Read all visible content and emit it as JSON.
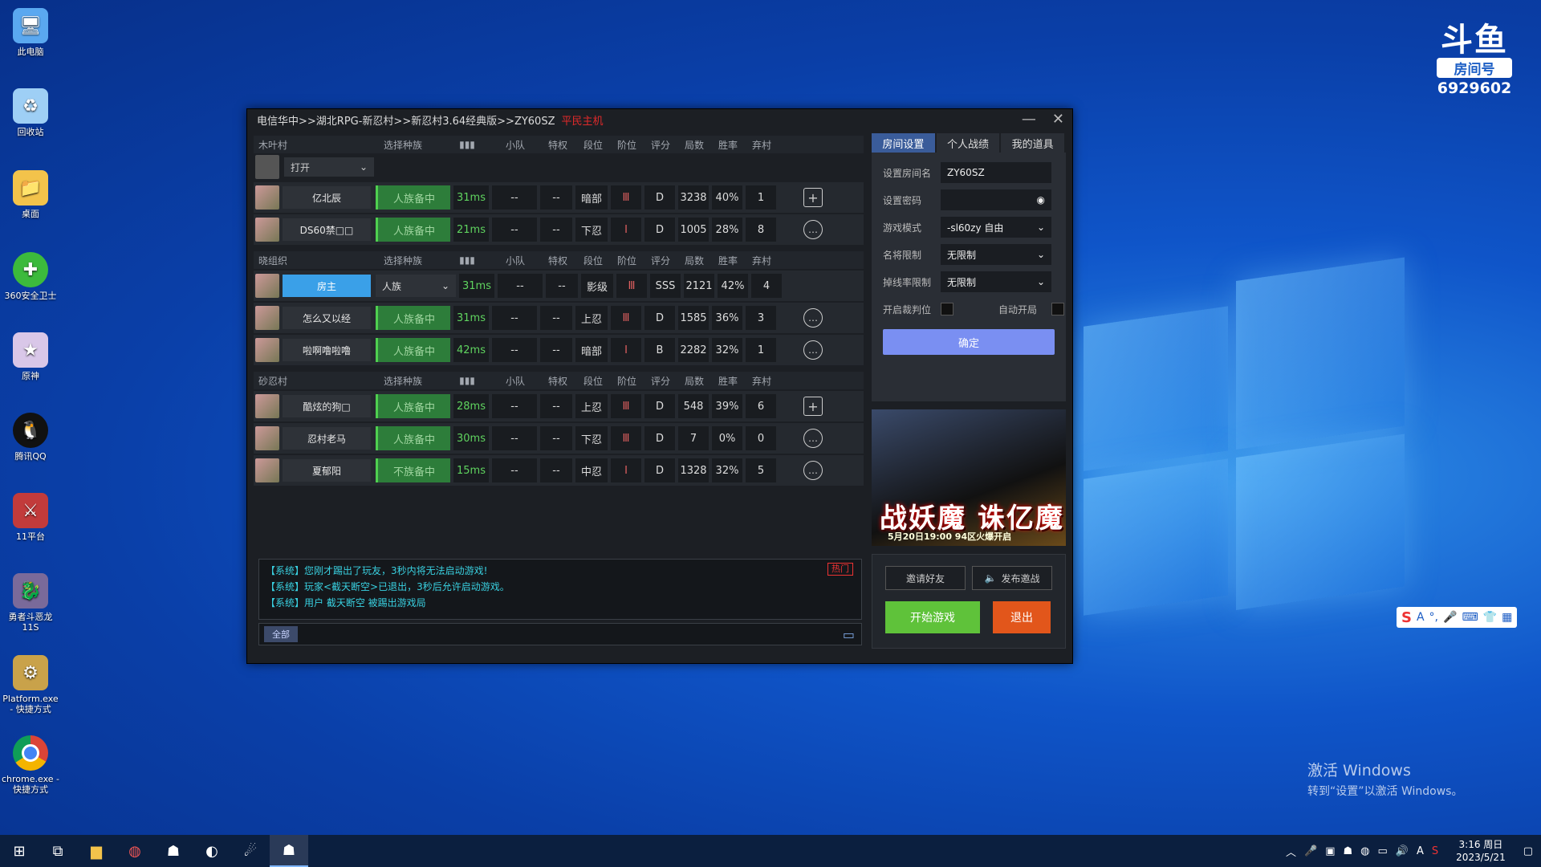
{
  "desktop": {
    "icons": [
      {
        "label": "此电脑",
        "icon": "computer-icon"
      },
      {
        "label": "回收站",
        "icon": "recycle-bin-icon"
      },
      {
        "label": "桌面",
        "icon": "folder-icon"
      },
      {
        "label": "360安全卫士",
        "icon": "360-icon"
      },
      {
        "label": "原神",
        "icon": "genshin-icon"
      },
      {
        "label": "腾讯QQ",
        "icon": "qq-icon"
      },
      {
        "label": "11平台",
        "icon": "11-platform-icon"
      },
      {
        "label": "勇者斗恶龙11S",
        "icon": "dragon-quest-icon"
      },
      {
        "label": "Platform.exe - 快捷方式",
        "icon": "platform-icon"
      },
      {
        "label": "chrome.exe - 快捷方式",
        "icon": "chrome-icon"
      }
    ],
    "douyu_mark": "斗鱼",
    "douyu_room_label": "房间号",
    "douyu_room_number": "6929602",
    "activate_title": "激活 Windows",
    "activate_sub": "转到“设置”以激活 Windows。"
  },
  "window": {
    "breadcrumb": "电信华中>>湖北RPG-新忍村>>新忍村3.64经典版>>ZY60SZ",
    "host_tag": "平民主机",
    "minimize": "—",
    "close": "✕"
  },
  "groups": [
    {
      "name": "木叶村",
      "headers": {
        "race": "选择种族",
        "team": "小队",
        "priv": "特权",
        "rank": "段位",
        "lvl": "阶位",
        "score": "评分",
        "games": "局数",
        "winrate": "胜率",
        "quit": "弃村"
      },
      "open_label": "打开",
      "players": [
        {
          "name": "亿北辰",
          "status": "人族备中",
          "ping": "31ms",
          "team": "--",
          "priv": "--",
          "rank": "暗部",
          "lvl": "Ⅲ",
          "score": "D",
          "games": "3238",
          "winrate": "40%",
          "quit": "1",
          "action": "plus"
        },
        {
          "name": "DS60禁□□",
          "status": "人族备中",
          "ping": "21ms",
          "team": "--",
          "priv": "--",
          "rank": "下忍",
          "lvl": "Ⅰ",
          "score": "D",
          "games": "1005",
          "winrate": "28%",
          "quit": "8",
          "action": "chat"
        }
      ]
    },
    {
      "name": "晓组织",
      "headers": {
        "race": "选择种族",
        "team": "小队",
        "priv": "特权",
        "rank": "段位",
        "lvl": "阶位",
        "score": "评分",
        "games": "局数",
        "winrate": "胜率",
        "quit": "弃村"
      },
      "players": [
        {
          "name": "房主",
          "me": true,
          "race": "人族",
          "ping": "31ms",
          "team": "--",
          "priv": "--",
          "rank": "影级",
          "lvl": "Ⅲ",
          "score": "SSS",
          "games": "2121",
          "winrate": "42%",
          "quit": "4",
          "action": "none"
        },
        {
          "name": "怎么又以经",
          "status": "人族备中",
          "ping": "31ms",
          "team": "--",
          "priv": "--",
          "rank": "上忍",
          "lvl": "Ⅲ",
          "score": "D",
          "games": "1585",
          "winrate": "36%",
          "quit": "3",
          "action": "chat"
        },
        {
          "name": "啦啊噜啦噜",
          "status": "人族备中",
          "ping": "42ms",
          "team": "--",
          "priv": "--",
          "rank": "暗部",
          "lvl": "Ⅰ",
          "score": "B",
          "games": "2282",
          "winrate": "32%",
          "quit": "1",
          "action": "chat"
        }
      ]
    },
    {
      "name": "砂忍村",
      "headers": {
        "race": "选择种族",
        "team": "小队",
        "priv": "特权",
        "rank": "段位",
        "lvl": "阶位",
        "score": "评分",
        "games": "局数",
        "winrate": "胜率",
        "quit": "弃村"
      },
      "players": [
        {
          "name": "酷炫的狗□",
          "status": "人族备中",
          "ping": "28ms",
          "team": "--",
          "priv": "--",
          "rank": "上忍",
          "lvl": "Ⅲ",
          "score": "D",
          "games": "548",
          "winrate": "39%",
          "quit": "6",
          "action": "plus"
        },
        {
          "name": "忍村老马",
          "status": "人族备中",
          "ping": "30ms",
          "team": "--",
          "priv": "--",
          "rank": "下忍",
          "lvl": "Ⅲ",
          "score": "D",
          "games": "7",
          "winrate": "0%",
          "quit": "0",
          "action": "chat"
        },
        {
          "name": "夏郁阳",
          "status": "不族备中",
          "ping": "15ms",
          "team": "--",
          "priv": "--",
          "rank": "中忍",
          "lvl": "Ⅰ",
          "score": "D",
          "games": "1328",
          "winrate": "32%",
          "quit": "5",
          "action": "chat"
        }
      ]
    }
  ],
  "chat": {
    "lines": [
      "【系统】您刚才踢出了玩友，3秒内将无法启动游戏!",
      "【系统】玩家<截天断空>已退出，3秒后允许启动游戏。",
      "【系统】用户 截天断空 被踢出游戏局"
    ],
    "hot_label": "热门",
    "channel": "全部"
  },
  "tabs": [
    "房间设置",
    "个人战绩",
    "我的道具"
  ],
  "settings": {
    "room_name_label": "设置房间名",
    "room_name": "ZY60SZ",
    "password_label": "设置密码",
    "mode_label": "游戏模式",
    "mode": "-sl60zy 自由",
    "hero_label": "名将限制",
    "hero": "无限制",
    "drop_label": "掉线率限制",
    "drop": "无限制",
    "judge_label": "开启裁判位",
    "autostart_label": "自动开局",
    "confirm": "确定"
  },
  "banner": {
    "title": "战妖魔 诛亿魔",
    "sub": "5月20日19:00 94区火爆开启"
  },
  "actions": {
    "invite": "邀请好友",
    "broadcast": "发布邀战",
    "start": "开始游戏",
    "exit": "退出"
  },
  "taskbar": {
    "time": "3:16 周日",
    "date": "2023/5/21",
    "ime": "A"
  }
}
